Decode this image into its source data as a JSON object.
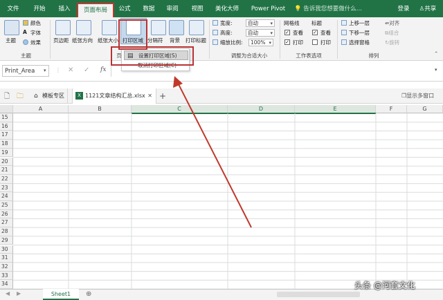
{
  "tabs": [
    {
      "label": "文件"
    },
    {
      "label": "开始"
    },
    {
      "label": "插入"
    },
    {
      "label": "页面布局"
    },
    {
      "label": "公式"
    },
    {
      "label": "数据"
    },
    {
      "label": "审阅"
    },
    {
      "label": "视图"
    },
    {
      "label": "美化大师"
    },
    {
      "label": "Power Pivot"
    }
  ],
  "search_placeholder": "告诉我您想要做什么...",
  "login_label": "登录",
  "share_label": "共享",
  "ribbon": {
    "theme_group": {
      "theme_label": "主题",
      "colors_label": "颜色",
      "fonts_label": "字体",
      "effects_label": "效果",
      "group_label": "主题"
    },
    "page_setup": {
      "margins_label": "页边距",
      "orientation_label": "纸张方向",
      "size_label": "纸张大小",
      "print_area_label": "打印区域",
      "breaks_label": "分隔符",
      "background_label": "背景",
      "print_titles_label": "打印标题",
      "group_label_partial": "页"
    },
    "scale_group": {
      "width_label": "宽度:",
      "width_value": "自动",
      "height_label": "高度:",
      "height_value": "自动",
      "scale_label": "缩放比例:",
      "scale_value": "100%",
      "group_label": "调整为合适大小"
    },
    "sheet_options": {
      "gridlines_label": "网格线",
      "headings_label": "标题",
      "view_label": "查看",
      "print_label": "打印",
      "gridlines_view": true,
      "gridlines_print": true,
      "headings_view": true,
      "headings_print": false,
      "group_label": "工作表选项"
    },
    "arrange": {
      "bring_forward_label": "上移一层",
      "send_backward_label": "下移一层",
      "selection_pane_label": "选择窗格",
      "align_label": "对齐",
      "group_label_btn": "组合",
      "rotate_label": "旋转",
      "group_label": "排列"
    }
  },
  "dropdown": {
    "set_print_area": "设置打印区域(S)",
    "clear_print_area": "取消打印区域(C)"
  },
  "formula_bar": {
    "name_box": "Print_Area",
    "fx": "fx"
  },
  "file_tabs": {
    "template_label": "模板专区",
    "file_label": "1121文章结构汇总.xlsx",
    "add_label": "+",
    "show_multi_window": "显示多窗口"
  },
  "columns": [
    "A",
    "B",
    "C",
    "D",
    "E",
    "F",
    "G"
  ],
  "rows": [
    "15",
    "16",
    "17",
    "18",
    "19",
    "20",
    "21",
    "22",
    "23",
    "24",
    "25",
    "26",
    "27",
    "28",
    "29",
    "30",
    "31",
    "32",
    "33",
    "34"
  ],
  "sheet_tab": "Sheet1",
  "watermark": "头条 @河套文化",
  "colors": {
    "excel_green": "#217346",
    "highlight_red": "#b83232",
    "arrow_red": "#c0392b"
  }
}
